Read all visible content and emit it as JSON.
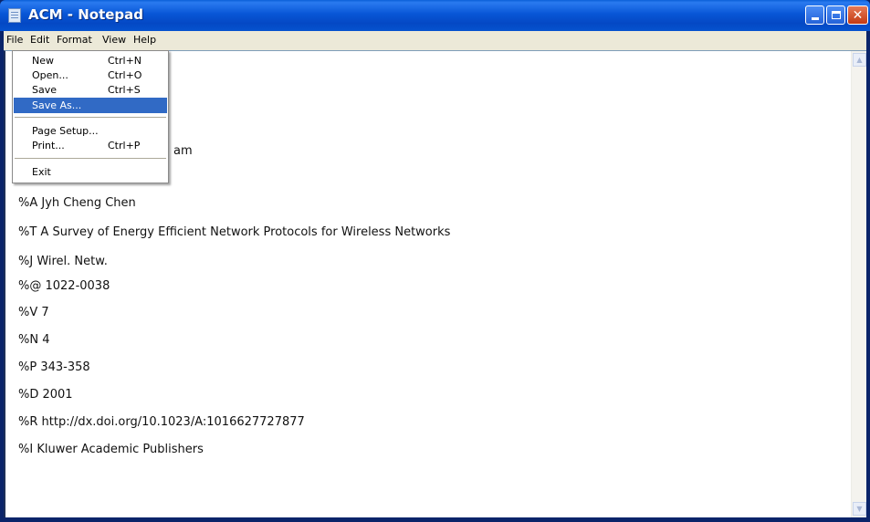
{
  "window": {
    "title": "ACM - Notepad",
    "controls": {
      "minimize": "",
      "maximize": "",
      "close": "✕"
    }
  },
  "menubar": {
    "items": [
      "File",
      "Edit",
      "Format",
      "View",
      "Help"
    ]
  },
  "file_menu": {
    "items": [
      {
        "label": "New",
        "shortcut": "Ctrl+N"
      },
      {
        "label": "Open...",
        "shortcut": "Ctrl+O"
      },
      {
        "label": "Save",
        "shortcut": "Ctrl+S"
      },
      {
        "label": "Save As...",
        "shortcut": ""
      },
      {
        "label": "Page Setup...",
        "shortcut": ""
      },
      {
        "label": "Print...",
        "shortcut": "Ctrl+P"
      },
      {
        "label": "Exit",
        "shortcut": ""
      }
    ],
    "highlighted": "Save As..."
  },
  "document": {
    "partial_line": "am",
    "lines": [
      "%A Jyh Cheng Chen",
      "%T A Survey of Energy Efficient Network Protocols for Wireless Networks",
      "%J Wirel. Netw.",
      "%@ 1022-0038",
      "%V 7",
      "%N 4",
      "%P 343-358",
      "%D 2001",
      "%R http://dx.doi.org/10.1023/A:1016627727877",
      "%I Kluwer Academic Publishers"
    ]
  },
  "colors": {
    "titlebar": "#0856d6",
    "menu_highlight": "#316ac5",
    "menubar": "#ece9d8"
  }
}
